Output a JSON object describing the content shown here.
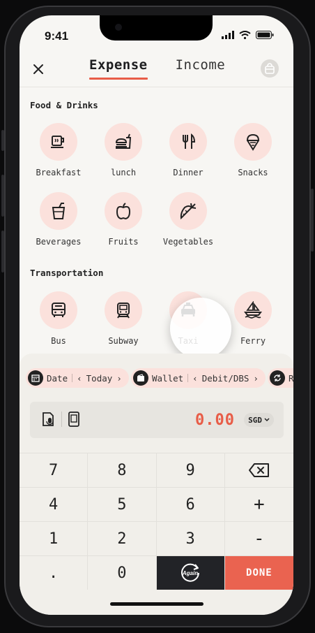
{
  "status_bar": {
    "time": "9:41"
  },
  "header": {
    "tabs": [
      {
        "label": "Expense",
        "active": true
      },
      {
        "label": "Income",
        "active": false
      }
    ]
  },
  "sections": [
    {
      "title": "Food & Drinks",
      "items": [
        {
          "label": "Breakfast",
          "icon": "coffee-cup-icon"
        },
        {
          "label": "lunch",
          "icon": "burger-drink-icon"
        },
        {
          "label": "Dinner",
          "icon": "fork-knife-icon"
        },
        {
          "label": "Snacks",
          "icon": "ice-cream-icon"
        },
        {
          "label": "Beverages",
          "icon": "glass-straw-icon"
        },
        {
          "label": "Fruits",
          "icon": "apple-icon"
        },
        {
          "label": "Vegetables",
          "icon": "carrot-icon"
        }
      ]
    },
    {
      "title": "Transportation",
      "items": [
        {
          "label": "Bus",
          "icon": "bus-icon"
        },
        {
          "label": "Subway",
          "icon": "train-icon"
        },
        {
          "label": "Taxi",
          "icon": "taxi-icon"
        },
        {
          "label": "Ferry",
          "icon": "ferry-icon"
        }
      ]
    }
  ],
  "chips": {
    "date": {
      "label": "Date",
      "value": "Today"
    },
    "wallet": {
      "label": "Wallet",
      "value": "Debit/DBS"
    },
    "repeat": {
      "label": "R"
    }
  },
  "amount": {
    "value": "0.00",
    "currency": "SGD"
  },
  "keypad": {
    "rows": [
      [
        "7",
        "8",
        "9",
        "backspace"
      ],
      [
        "4",
        "5",
        "6",
        "+"
      ],
      [
        "1",
        "2",
        "3",
        "-"
      ],
      [
        ".",
        "0",
        "Again",
        "DONE"
      ]
    ]
  },
  "colors": {
    "accent": "#e85d48",
    "chip_bg": "#fbe1dc",
    "dark": "#222327"
  }
}
